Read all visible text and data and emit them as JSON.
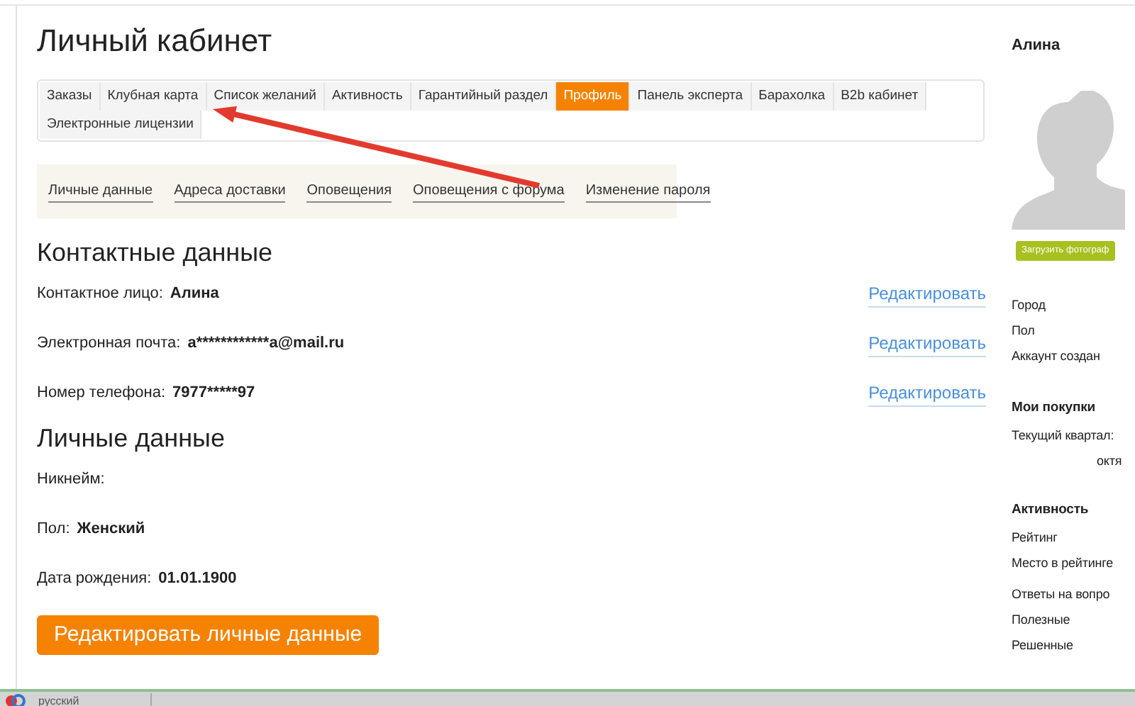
{
  "title": "Личный кабинет",
  "tabs": [
    {
      "label": "Заказы",
      "selected": false
    },
    {
      "label": "Клубная карта",
      "selected": false
    },
    {
      "label": "Список желаний",
      "selected": false
    },
    {
      "label": "Активность",
      "selected": false
    },
    {
      "label": "Гарантийный раздел",
      "selected": false
    },
    {
      "label": "Профиль",
      "selected": true
    },
    {
      "label": "Панель эксперта",
      "selected": false
    },
    {
      "label": "Барахолка",
      "selected": false
    },
    {
      "label": "B2b кабинет",
      "selected": false
    },
    {
      "label": "Электронные лицензии",
      "selected": false
    }
  ],
  "subnav": [
    {
      "label": "Личные данные"
    },
    {
      "label": "Адреса доставки"
    },
    {
      "label": "Оповещения"
    },
    {
      "label": "Оповещения с форума"
    },
    {
      "label": "Изменение пароля"
    }
  ],
  "contact": {
    "title": "Контактные данные",
    "rows": [
      {
        "label": "Контактное лицо:",
        "value": "Алина",
        "action": "Редактировать"
      },
      {
        "label": "Электронная почта:",
        "value": "a************a@mail.ru",
        "action": "Редактировать"
      },
      {
        "label": "Номер телефона:",
        "value": "7977*****97",
        "action": "Редактировать"
      }
    ]
  },
  "personal": {
    "title": "Личные данные",
    "rows": [
      {
        "label": "Никнейм:"
      },
      {
        "label": "Пол:",
        "value": "Женский"
      },
      {
        "label": "Дата рождения:",
        "value": "01.01.1900"
      }
    ]
  },
  "edit_button": "Редактировать личные данные",
  "sidebar": {
    "user_name": "Алина",
    "upload_button": "Загрузить фотограф",
    "info": [
      "Город",
      "Пол",
      "Аккаунт создан"
    ],
    "purchases": {
      "title": "Мои покупки",
      "lines": [
        "Текущий квартал:",
        "октя"
      ]
    },
    "activity": {
      "title": "Активность",
      "items": [
        "Рейтинг",
        "Место в рейтинге",
        "Ответы на вопро",
        "Полезные",
        "Решенные"
      ]
    }
  },
  "taskbar": {
    "language": "русский"
  }
}
